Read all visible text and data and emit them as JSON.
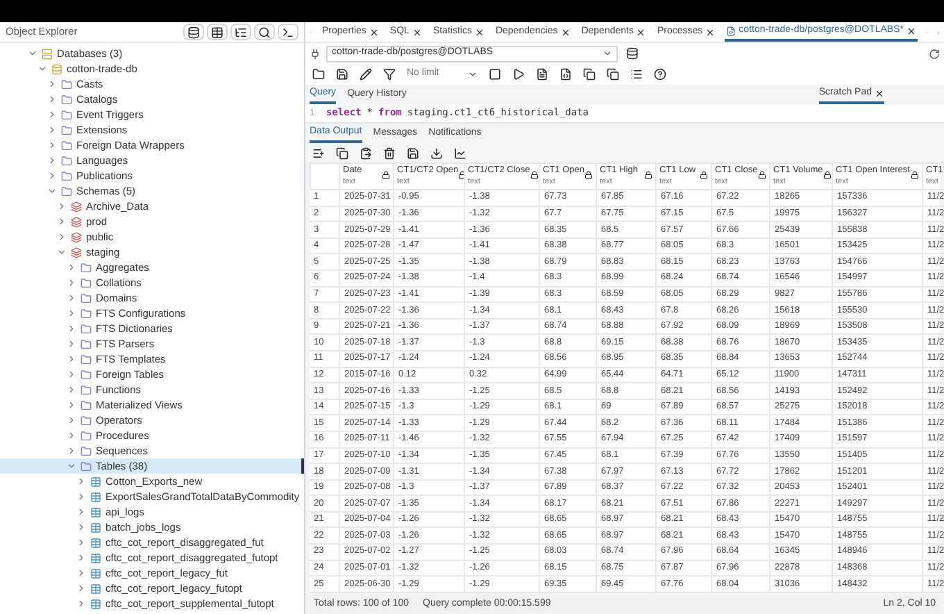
{
  "explorer": {
    "title": "Object Explorer",
    "tree": [
      {
        "label": "Databases (3)",
        "kind": "group",
        "expanded": true,
        "selected": false,
        "children": [
          {
            "label": "cotton-trade-db",
            "kind": "database",
            "expanded": true,
            "selected": false,
            "children": [
              {
                "label": "Casts",
                "kind": "folder",
                "expanded": false,
                "selected": false
              },
              {
                "label": "Catalogs",
                "kind": "folder",
                "expanded": false,
                "selected": false
              },
              {
                "label": "Event Triggers",
                "kind": "folder",
                "expanded": false,
                "selected": false
              },
              {
                "label": "Extensions",
                "kind": "folder",
                "expanded": false,
                "selected": false
              },
              {
                "label": "Foreign Data Wrappers",
                "kind": "folder",
                "expanded": false,
                "selected": false
              },
              {
                "label": "Languages",
                "kind": "folder",
                "expanded": false,
                "selected": false
              },
              {
                "label": "Publications",
                "kind": "folder",
                "expanded": false,
                "selected": false
              },
              {
                "label": "Schemas (5)",
                "kind": "folder",
                "expanded": true,
                "selected": false,
                "children": [
                  {
                    "label": "Archive_Data",
                    "kind": "schema",
                    "expanded": false,
                    "selected": false
                  },
                  {
                    "label": "prod",
                    "kind": "schema",
                    "expanded": false,
                    "selected": false
                  },
                  {
                    "label": "public",
                    "kind": "schema",
                    "expanded": false,
                    "selected": false
                  },
                  {
                    "label": "staging",
                    "kind": "schema",
                    "expanded": true,
                    "selected": false,
                    "children": [
                      {
                        "label": "Aggregates",
                        "kind": "folder",
                        "expanded": false,
                        "selected": false
                      },
                      {
                        "label": "Collations",
                        "kind": "folder",
                        "expanded": false,
                        "selected": false
                      },
                      {
                        "label": "Domains",
                        "kind": "folder",
                        "expanded": false,
                        "selected": false
                      },
                      {
                        "label": "FTS Configurations",
                        "kind": "folder",
                        "expanded": false,
                        "selected": false
                      },
                      {
                        "label": "FTS Dictionaries",
                        "kind": "folder",
                        "expanded": false,
                        "selected": false
                      },
                      {
                        "label": "FTS Parsers",
                        "kind": "folder",
                        "expanded": false,
                        "selected": false
                      },
                      {
                        "label": "FTS Templates",
                        "kind": "folder",
                        "expanded": false,
                        "selected": false
                      },
                      {
                        "label": "Foreign Tables",
                        "kind": "folder",
                        "expanded": false,
                        "selected": false
                      },
                      {
                        "label": "Functions",
                        "kind": "folder",
                        "expanded": false,
                        "selected": false
                      },
                      {
                        "label": "Materialized Views",
                        "kind": "folder",
                        "expanded": false,
                        "selected": false
                      },
                      {
                        "label": "Operators",
                        "kind": "folder",
                        "expanded": false,
                        "selected": false
                      },
                      {
                        "label": "Procedures",
                        "kind": "folder",
                        "expanded": false,
                        "selected": false
                      },
                      {
                        "label": "Sequences",
                        "kind": "folder",
                        "expanded": false,
                        "selected": false
                      },
                      {
                        "label": "Tables (38)",
                        "kind": "folder",
                        "expanded": true,
                        "selected": true,
                        "children": [
                          {
                            "label": "Cotton_Exports_new",
                            "kind": "table",
                            "expanded": false,
                            "selected": false
                          },
                          {
                            "label": "ExportSalesGrandTotalDataByCommodity",
                            "kind": "table",
                            "expanded": false,
                            "selected": false
                          },
                          {
                            "label": "api_logs",
                            "kind": "table",
                            "expanded": false,
                            "selected": false
                          },
                          {
                            "label": "batch_jobs_logs",
                            "kind": "table",
                            "expanded": false,
                            "selected": false
                          },
                          {
                            "label": "cftc_cot_report_disaggregated_fut",
                            "kind": "table",
                            "expanded": false,
                            "selected": false
                          },
                          {
                            "label": "cftc_cot_report_disaggregated_futopt",
                            "kind": "table",
                            "expanded": false,
                            "selected": false
                          },
                          {
                            "label": "cftc_cot_report_legacy_fut",
                            "kind": "table",
                            "expanded": false,
                            "selected": false
                          },
                          {
                            "label": "cftc_cot_report_legacy_futopt",
                            "kind": "table",
                            "expanded": false,
                            "selected": false
                          },
                          {
                            "label": "cftc_cot_report_supplemental_futopt",
                            "kind": "table",
                            "expanded": false,
                            "selected": false
                          }
                        ]
                      }
                    ]
                  }
                ]
              }
            ]
          }
        ]
      }
    ]
  },
  "tabs": [
    {
      "label": "Properties",
      "selected": false
    },
    {
      "label": "SQL",
      "selected": false
    },
    {
      "label": "Statistics",
      "selected": false
    },
    {
      "label": "Dependencies",
      "selected": false
    },
    {
      "label": "Dependents",
      "selected": false
    },
    {
      "label": "Processes",
      "selected": false
    },
    {
      "label": "cotton-trade-db/postgres@DOTLABS*",
      "selected": true
    }
  ],
  "connection": "cotton-trade-db/postgres@DOTLABS",
  "limit": "No limit",
  "query_tabs": [
    {
      "label": "Query",
      "selected": true
    },
    {
      "label": "Query History",
      "selected": false
    }
  ],
  "scratch_pad": "Scratch Pad",
  "editor": {
    "line": "1",
    "tokens": [
      {
        "text": "select",
        "kind": "keyword"
      },
      {
        "text": "*",
        "kind": "plain"
      },
      {
        "text": "from",
        "kind": "keyword"
      },
      {
        "text": "staging.ct1_ct6_historical_data",
        "kind": "plain"
      }
    ]
  },
  "result_tabs": [
    {
      "label": "Data Output",
      "selected": true
    },
    {
      "label": "Messages",
      "selected": false
    },
    {
      "label": "Notifications",
      "selected": false
    }
  ],
  "table": {
    "columns": [
      {
        "name": "Date",
        "type": "text"
      },
      {
        "name": "CT1/CT2 Open",
        "type": "text"
      },
      {
        "name": "CT1/CT2 Close",
        "type": "text"
      },
      {
        "name": "CT1 Open",
        "type": "text"
      },
      {
        "name": "CT1 High",
        "type": "text"
      },
      {
        "name": "CT1 Low",
        "type": "text"
      },
      {
        "name": "CT1 Close",
        "type": "text"
      },
      {
        "name": "CT1 Volume",
        "type": "text"
      },
      {
        "name": "CT1 Open Interest",
        "type": "text"
      },
      {
        "name": "CT1",
        "type": "text"
      }
    ],
    "rows": [
      {
        "number": "1",
        "cells": [
          "2025-07-31",
          "-0.95",
          "-1.38",
          "67.73",
          "67.85",
          "67.16",
          "67.22",
          "18265",
          "157336",
          "11/2"
        ]
      },
      {
        "number": "2",
        "cells": [
          "2025-07-30",
          "-1.36",
          "-1.32",
          "67.7",
          "67.75",
          "67.15",
          "67.5",
          "19975",
          "156327",
          "11/2"
        ]
      },
      {
        "number": "3",
        "cells": [
          "2025-07-29",
          "-1.41",
          "-1.36",
          "68.35",
          "68.5",
          "67.57",
          "67.66",
          "25439",
          "155838",
          "11/2"
        ]
      },
      {
        "number": "4",
        "cells": [
          "2025-07-28",
          "-1.47",
          "-1.41",
          "68.38",
          "68.77",
          "68.05",
          "68.3",
          "16501",
          "153425",
          "11/2"
        ]
      },
      {
        "number": "5",
        "cells": [
          "2025-07-25",
          "-1.35",
          "-1.38",
          "68.79",
          "68.83",
          "68.15",
          "68.23",
          "13763",
          "154766",
          "11/2"
        ]
      },
      {
        "number": "6",
        "cells": [
          "2025-07-24",
          "-1.38",
          "-1.4",
          "68.3",
          "68.99",
          "68.24",
          "68.74",
          "16546",
          "154997",
          "11/2"
        ]
      },
      {
        "number": "7",
        "cells": [
          "2025-07-23",
          "-1.41",
          "-1.39",
          "68.3",
          "68.59",
          "68.05",
          "68.29",
          "9827",
          "155786",
          "11/2"
        ]
      },
      {
        "number": "8",
        "cells": [
          "2025-07-22",
          "-1.36",
          "-1.34",
          "68.1",
          "68.43",
          "67.8",
          "68.26",
          "15618",
          "155530",
          "11/2"
        ]
      },
      {
        "number": "9",
        "cells": [
          "2025-07-21",
          "-1.36",
          "-1.37",
          "68.74",
          "68.88",
          "67.92",
          "68.09",
          "18969",
          "153508",
          "11/2"
        ]
      },
      {
        "number": "10",
        "cells": [
          "2025-07-18",
          "-1.37",
          "-1.3",
          "68.8",
          "69.15",
          "68.38",
          "68.76",
          "18670",
          "153435",
          "11/2"
        ]
      },
      {
        "number": "11",
        "cells": [
          "2025-07-17",
          "-1.24",
          "-1.24",
          "68.56",
          "68.95",
          "68.35",
          "68.84",
          "13653",
          "152744",
          "11/2"
        ]
      },
      {
        "number": "12",
        "cells": [
          "2015-07-16",
          "0.12",
          "0.32",
          "64.99",
          "65.44",
          "64.71",
          "65.12",
          "11900",
          "147311",
          "11/2"
        ]
      },
      {
        "number": "13",
        "cells": [
          "2025-07-16",
          "-1.33",
          "-1.25",
          "68.5",
          "68.8",
          "68.21",
          "68.56",
          "14193",
          "152492",
          "11/2"
        ]
      },
      {
        "number": "14",
        "cells": [
          "2025-07-15",
          "-1.3",
          "-1.29",
          "68.1",
          "69",
          "67.89",
          "68.57",
          "25275",
          "152018",
          "11/2"
        ]
      },
      {
        "number": "15",
        "cells": [
          "2025-07-14",
          "-1.33",
          "-1.29",
          "67.44",
          "68.2",
          "67.36",
          "68.11",
          "17484",
          "151386",
          "11/2"
        ]
      },
      {
        "number": "16",
        "cells": [
          "2025-07-11",
          "-1.46",
          "-1.32",
          "67.55",
          "67.94",
          "67.25",
          "67.42",
          "17409",
          "151597",
          "11/2"
        ]
      },
      {
        "number": "17",
        "cells": [
          "2025-07-10",
          "-1.34",
          "-1.35",
          "67.45",
          "68.1",
          "67.39",
          "67.76",
          "13550",
          "151405",
          "11/2"
        ]
      },
      {
        "number": "18",
        "cells": [
          "2025-07-09",
          "-1.31",
          "-1.34",
          "67.38",
          "67.97",
          "67.13",
          "67.72",
          "17862",
          "151201",
          "11/2"
        ]
      },
      {
        "number": "19",
        "cells": [
          "2025-07-08",
          "-1.3",
          "-1.37",
          "67.89",
          "68.37",
          "67.22",
          "67.32",
          "20453",
          "152401",
          "11/2"
        ]
      },
      {
        "number": "20",
        "cells": [
          "2025-07-07",
          "-1.35",
          "-1.34",
          "68.17",
          "68.21",
          "67.51",
          "67.86",
          "22271",
          "149297",
          "11/2"
        ]
      },
      {
        "number": "21",
        "cells": [
          "2025-07-04",
          "-1.26",
          "-1.32",
          "68.65",
          "68.97",
          "68.21",
          "68.43",
          "15470",
          "148755",
          "11/2"
        ]
      },
      {
        "number": "22",
        "cells": [
          "2025-07-03",
          "-1.26",
          "-1.32",
          "68.65",
          "68.97",
          "68.21",
          "68.43",
          "15470",
          "148755",
          "11/2"
        ]
      },
      {
        "number": "23",
        "cells": [
          "2025-07-02",
          "-1.27",
          "-1.25",
          "68.03",
          "68.74",
          "67.96",
          "68.64",
          "16345",
          "148946",
          "11/2"
        ]
      },
      {
        "number": "24",
        "cells": [
          "2025-07-01",
          "-1.32",
          "-1.26",
          "68.15",
          "68.75",
          "67.87",
          "67.96",
          "22878",
          "148368",
          "11/2"
        ]
      },
      {
        "number": "25",
        "cells": [
          "2025-06-30",
          "-1.29",
          "-1.29",
          "69.35",
          "69.45",
          "67.76",
          "68.04",
          "31036",
          "148432",
          "11/2"
        ]
      }
    ]
  },
  "status": {
    "rows": "Total rows: 100 of 100",
    "query": "Query complete 00:00:15.599",
    "cursor": "Ln 2, Col 10"
  }
}
